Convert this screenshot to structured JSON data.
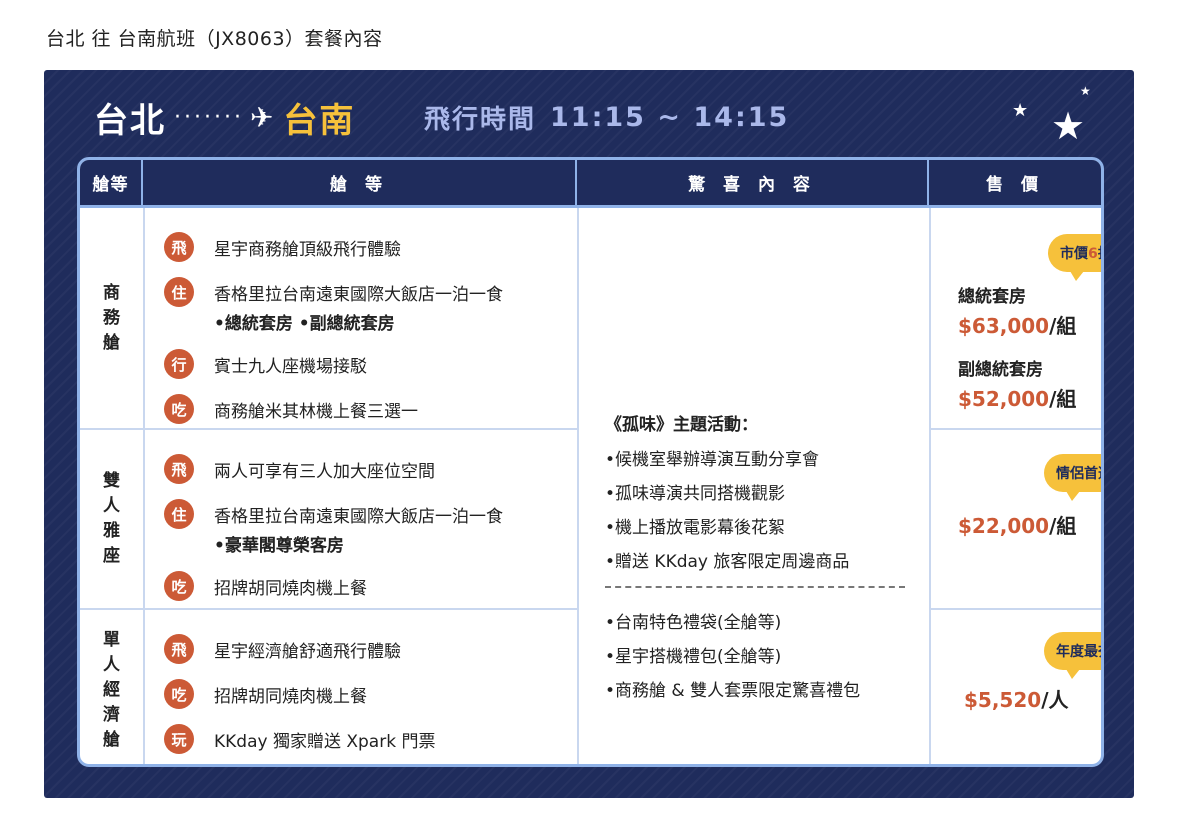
{
  "page_title": "台北 往 台南航班（JX8063）套餐內容",
  "banner": {
    "from": "台北",
    "dots": "·······",
    "to": "台南",
    "flight_time_label": "飛行時間",
    "flight_time_value": "11:15 ~ 14:15"
  },
  "table": {
    "headers": {
      "class": "艙等",
      "content": "艙 等",
      "surprise": "驚 喜 內 容",
      "price": "售 價"
    },
    "rows": [
      {
        "class_chars": [
          "商",
          "務",
          "艙"
        ],
        "perks": [
          {
            "tag": "飛",
            "text": "星宇商務艙頂級飛行體驗"
          },
          {
            "tag": "住",
            "text": "香格里拉台南遠東國際大飯店一泊一食",
            "sub": "•總統套房 •副總統套房"
          },
          {
            "tag": "行",
            "text": "賓士九人座機場接駁"
          },
          {
            "tag": "吃",
            "text": "商務艙米其林機上餐三選一"
          }
        ],
        "badge": {
          "prefix": "市價",
          "highlight": "6",
          "suffix": "折"
        },
        "prices": [
          {
            "label": "總統套房",
            "amount": "$63,000",
            "unit": "/組"
          },
          {
            "label": "副總統套房",
            "amount": "$52,000",
            "unit": "/組"
          }
        ]
      },
      {
        "class_chars": [
          "雙",
          "人",
          "雅",
          "座"
        ],
        "perks": [
          {
            "tag": "飛",
            "text": "兩人可享有三人加大座位空間"
          },
          {
            "tag": "住",
            "text": "香格里拉台南遠東國際大飯店一泊一食",
            "sub": "•豪華閣尊榮客房"
          },
          {
            "tag": "吃",
            "text": "招牌胡同燒肉機上餐"
          }
        ],
        "badge": {
          "text": "情侶首選"
        },
        "prices": [
          {
            "amount": "$22,000",
            "unit": "/組"
          }
        ]
      },
      {
        "class_chars": [
          "單",
          "人",
          "經",
          "濟",
          "艙"
        ],
        "perks": [
          {
            "tag": "飛",
            "text": "星宇經濟艙舒適飛行體驗"
          },
          {
            "tag": "吃",
            "text": "招牌胡同燒肉機上餐"
          },
          {
            "tag": "玩",
            "text": "KKday 獨家贈送 Xpark 門票"
          }
        ],
        "badge": {
          "text": "年度最夯"
        },
        "prices": [
          {
            "amount": "$5,520",
            "unit": "/人"
          }
        ]
      }
    ],
    "surprise": {
      "heading": "《孤味》主題活動：",
      "items_a": [
        "•候機室舉辦導演互動分享會",
        "•孤味導演共同搭機觀影",
        "•機上播放電影幕後花絮",
        "•贈送 KKday 旅客限定周邊商品"
      ],
      "items_b": [
        "•台南特色禮袋(全艙等)",
        "•星宇搭機禮包(全艙等)",
        "•商務艙 & 雙人套票限定驚喜禮包"
      ]
    }
  },
  "colors": {
    "navy": "#1f2c5c",
    "accent_yellow": "#f6c13b",
    "accent_orange": "#cc5a36",
    "border_blue": "#8fb2e8"
  }
}
